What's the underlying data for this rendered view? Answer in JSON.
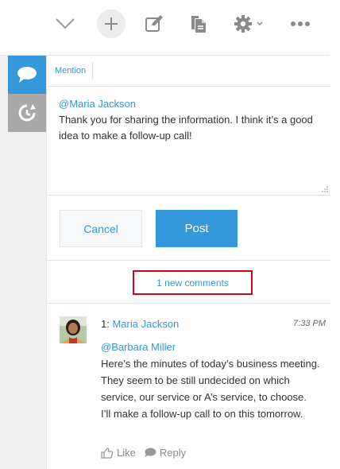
{
  "toolbar": {
    "items": [
      {
        "name": "chevron-down-icon"
      },
      {
        "name": "plus-icon"
      },
      {
        "name": "edit-icon"
      },
      {
        "name": "copy-document-icon"
      },
      {
        "name": "gear-icon"
      },
      {
        "name": "more-icon"
      }
    ]
  },
  "sidebar": {
    "tabs": [
      {
        "name": "comments-tab",
        "icon": "speech-bubble-icon",
        "active": true
      },
      {
        "name": "history-tab",
        "icon": "history-icon",
        "active": false
      }
    ]
  },
  "editor": {
    "mention_link": "Mention",
    "mention": "@Maria Jackson",
    "text": "Thank you for sharing the information. I think it’s a good idea to make a follow-up call!"
  },
  "buttons": {
    "cancel": "Cancel",
    "post": "Post"
  },
  "new_comments": "1 new comments",
  "comment": {
    "number": "1:",
    "author": "Maria Jackson",
    "time": "7:33 PM",
    "mention": "@Barbara Miller",
    "lines": [
      "Here’s the minutes of today’s business meeting.",
      "They seem to be still undecided on which service, our service or A’s service, to choose.",
      "I’ll make a follow-up call to on this tomorrow."
    ],
    "like": "Like",
    "reply": "Reply"
  },
  "colors": {
    "accent": "#3498db",
    "highlight_border": "#d0021b",
    "rail_active": "#3498db",
    "rail_inactive": "#a9a9a9"
  }
}
